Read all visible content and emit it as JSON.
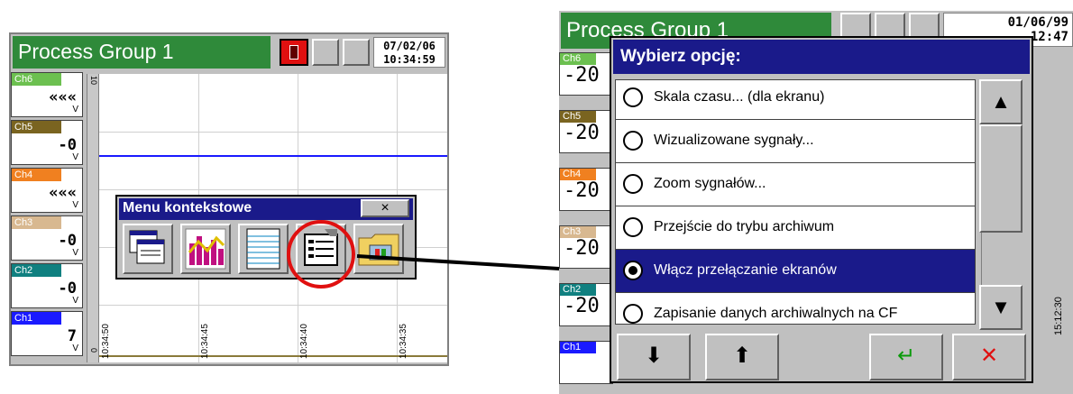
{
  "left": {
    "title": "Process Group 1",
    "date": "07/02/06",
    "time": "10:34:59",
    "scale_top": "10",
    "scale_bottom": "0",
    "channels": [
      {
        "name": "Ch6",
        "value": "«««",
        "unit": "V",
        "color": "#6cc050"
      },
      {
        "name": "Ch5",
        "value": "-0",
        "unit": "V",
        "color": "#7a6420"
      },
      {
        "name": "Ch4",
        "value": "«««",
        "unit": "V",
        "color": "#f08020"
      },
      {
        "name": "Ch3",
        "value": "-0",
        "unit": "V",
        "color": "#d8b890"
      },
      {
        "name": "Ch2",
        "value": "-0",
        "unit": "V",
        "color": "#108080"
      },
      {
        "name": "Ch1",
        "value": "7",
        "unit": "V",
        "color": "#1a1aff"
      }
    ],
    "time_labels": [
      "10:34:50",
      "10:34:45",
      "10:34:40",
      "10:34:35"
    ],
    "context_menu": {
      "title": "Menu kontekstowe",
      "close": "×",
      "icons": [
        "windows-icon",
        "chart-bars-icon",
        "notepad-icon",
        "settings-list-icon",
        "folder-icon"
      ]
    }
  },
  "right": {
    "title": "Process Group 1",
    "date": "01/06/99",
    "time": "12:47",
    "channels": [
      {
        "name": "Ch6",
        "value": "-20",
        "color": "#6cc050"
      },
      {
        "name": "Ch5",
        "value": "-20",
        "color": "#7a6420"
      },
      {
        "name": "Ch4",
        "value": "-20",
        "color": "#f08020"
      },
      {
        "name": "Ch3",
        "value": "-20",
        "color": "#d8b890"
      },
      {
        "name": "Ch2",
        "value": "-20",
        "color": "#108080"
      },
      {
        "name": "Ch1",
        "value": "",
        "color": "#1a1aff"
      }
    ],
    "bottom_time": "15:12:30",
    "dialog": {
      "title": "Wybierz opcję:",
      "options": [
        {
          "label": "Skala czasu... (dla ekranu)",
          "selected": false
        },
        {
          "label": "Wizualizowane sygnały...",
          "selected": false
        },
        {
          "label": "Zoom sygnałów...",
          "selected": false
        },
        {
          "label": "Przejście do trybu archiwum",
          "selected": false
        },
        {
          "label": "Włącz przełączanie ekranów",
          "selected": true
        },
        {
          "label": "Zapisanie danych archiwalnych na CF",
          "selected": false
        }
      ],
      "scroll_up": "▲",
      "scroll_down": "▼",
      "btn_down": "⬇",
      "btn_up": "⬆",
      "btn_enter": "↵",
      "btn_cancel": "✕",
      "accent_enter": "#0a9a0a",
      "accent_cancel": "#e01010"
    }
  }
}
